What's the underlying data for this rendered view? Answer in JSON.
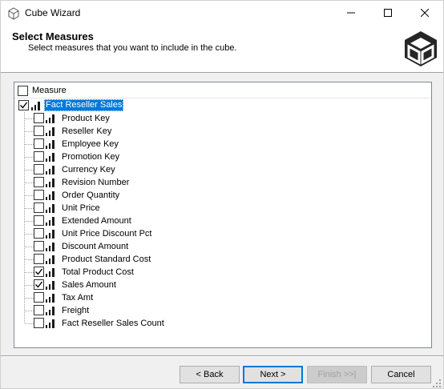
{
  "window": {
    "title": "Cube Wizard"
  },
  "header": {
    "title": "Select Measures",
    "subtitle": "Select measures that you want to include in the cube."
  },
  "tree": {
    "column_header": "Measure",
    "header_checked": false,
    "root": {
      "label": "Fact Reseller Sales",
      "checked": true,
      "selected": true
    },
    "items": [
      {
        "label": "Product Key",
        "checked": false
      },
      {
        "label": "Reseller Key",
        "checked": false
      },
      {
        "label": "Employee Key",
        "checked": false
      },
      {
        "label": "Promotion Key",
        "checked": false
      },
      {
        "label": "Currency Key",
        "checked": false
      },
      {
        "label": "Revision Number",
        "checked": false
      },
      {
        "label": "Order Quantity",
        "checked": false
      },
      {
        "label": "Unit Price",
        "checked": false
      },
      {
        "label": "Extended Amount",
        "checked": false
      },
      {
        "label": "Unit Price Discount Pct",
        "checked": false
      },
      {
        "label": "Discount Amount",
        "checked": false
      },
      {
        "label": "Product Standard Cost",
        "checked": false
      },
      {
        "label": "Total Product Cost",
        "checked": true
      },
      {
        "label": "Sales Amount",
        "checked": true
      },
      {
        "label": "Tax Amt",
        "checked": false
      },
      {
        "label": "Freight",
        "checked": false
      },
      {
        "label": "Fact Reseller Sales Count",
        "checked": false
      }
    ]
  },
  "buttons": {
    "back": "< Back",
    "next": "Next >",
    "finish": "Finish >>|",
    "cancel": "Cancel"
  },
  "icons": {
    "app": "cube-icon",
    "logo": "cube-logo-icon",
    "measure": "bar-chart-icon"
  },
  "colors": {
    "selection": "#0078d7",
    "focus_border": "#0078d7"
  }
}
